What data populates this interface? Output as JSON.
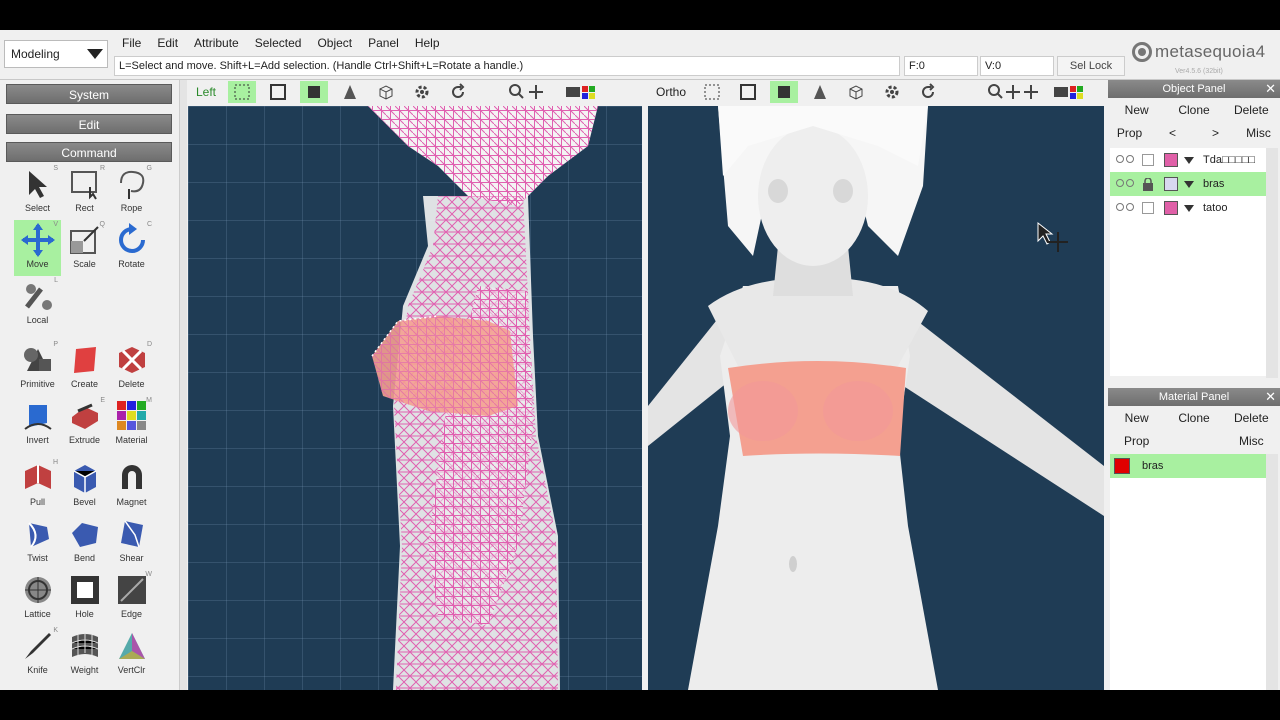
{
  "mode": "Modeling",
  "menu": [
    "File",
    "Edit",
    "Attribute",
    "Selected",
    "Object",
    "Panel",
    "Help"
  ],
  "hint": "L=Select and move.  Shift+L=Add selection.  (Handle Ctrl+Shift+L=Rotate a handle.)",
  "status": {
    "f": "F:0",
    "v": "V:0",
    "sel_lock": "Sel Lock"
  },
  "logo": {
    "name": "metasequoia4",
    "version": "Ver4.5.6 (32bit)"
  },
  "left_panel": {
    "system": "System",
    "edit": "Edit",
    "command": "Command",
    "tools": [
      {
        "label": "Select",
        "key": "S",
        "icon": "cursor-icon"
      },
      {
        "label": "Rect",
        "key": "R",
        "icon": "rect-select-icon"
      },
      {
        "label": "Rope",
        "key": "G",
        "icon": "lasso-icon"
      },
      {
        "label": "Move",
        "key": "V",
        "icon": "move-arrows-icon",
        "active": true
      },
      {
        "label": "Scale",
        "key": "Q",
        "icon": "scale-icon"
      },
      {
        "label": "Rotate",
        "key": "C",
        "icon": "rotate-icon"
      },
      {
        "label": "Local",
        "key": "L",
        "icon": "local-axis-icon"
      },
      {
        "label": "Primitive",
        "key": "P",
        "icon": "primitive-icon"
      },
      {
        "label": "Create",
        "key": "",
        "icon": "create-face-icon"
      },
      {
        "label": "Delete",
        "key": "D",
        "icon": "delete-face-icon"
      },
      {
        "label": "Invert",
        "key": "",
        "icon": "invert-icon"
      },
      {
        "label": "Extrude",
        "key": "E",
        "icon": "extrude-icon"
      },
      {
        "label": "Material",
        "key": "M",
        "icon": "material-icon"
      },
      {
        "label": "Pull",
        "key": "H",
        "icon": "pull-icon"
      },
      {
        "label": "Bevel",
        "key": "",
        "icon": "bevel-icon"
      },
      {
        "label": "Magnet",
        "key": "",
        "icon": "magnet-icon"
      },
      {
        "label": "Twist",
        "key": "",
        "icon": "twist-icon"
      },
      {
        "label": "Bend",
        "key": "",
        "icon": "bend-icon"
      },
      {
        "label": "Shear",
        "key": "",
        "icon": "shear-icon"
      },
      {
        "label": "Lattice",
        "key": "",
        "icon": "lattice-icon"
      },
      {
        "label": "Hole",
        "key": "",
        "icon": "hole-icon"
      },
      {
        "label": "Edge",
        "key": "W",
        "icon": "edge-icon"
      },
      {
        "label": "Knife",
        "key": "K",
        "icon": "knife-icon"
      },
      {
        "label": "Weight",
        "key": "",
        "icon": "weight-icon"
      },
      {
        "label": "VertClr",
        "key": "",
        "icon": "vertex-color-icon"
      }
    ]
  },
  "viewports": {
    "left": {
      "label": "Left"
    },
    "right": {
      "label": "Ortho"
    }
  },
  "object_panel": {
    "title": "Object Panel",
    "row1": [
      "New",
      "Clone",
      "Delete"
    ],
    "row2": [
      "Prop",
      "<",
      ">",
      "Misc"
    ],
    "objects": [
      {
        "name": "Tda□□□□□",
        "color": "#e060a8",
        "selected": false,
        "locked": false
      },
      {
        "name": "bras",
        "color": "#d8d8f0",
        "selected": true,
        "locked": true
      },
      {
        "name": "tatoo",
        "color": "#e060a8",
        "selected": false,
        "locked": false
      }
    ]
  },
  "material_panel": {
    "title": "Material Panel",
    "row1": [
      "New",
      "Clone",
      "Delete"
    ],
    "row2": [
      "Prop",
      "",
      "Misc"
    ],
    "materials": [
      {
        "name": "bras",
        "color": "#e00000",
        "selected": true
      }
    ]
  },
  "colors": {
    "accent_green": "#a8f0a0",
    "viewport_bg": "#1f3c55",
    "wire_pink": "#e060b0",
    "bra_salmon": "#f4a090"
  }
}
